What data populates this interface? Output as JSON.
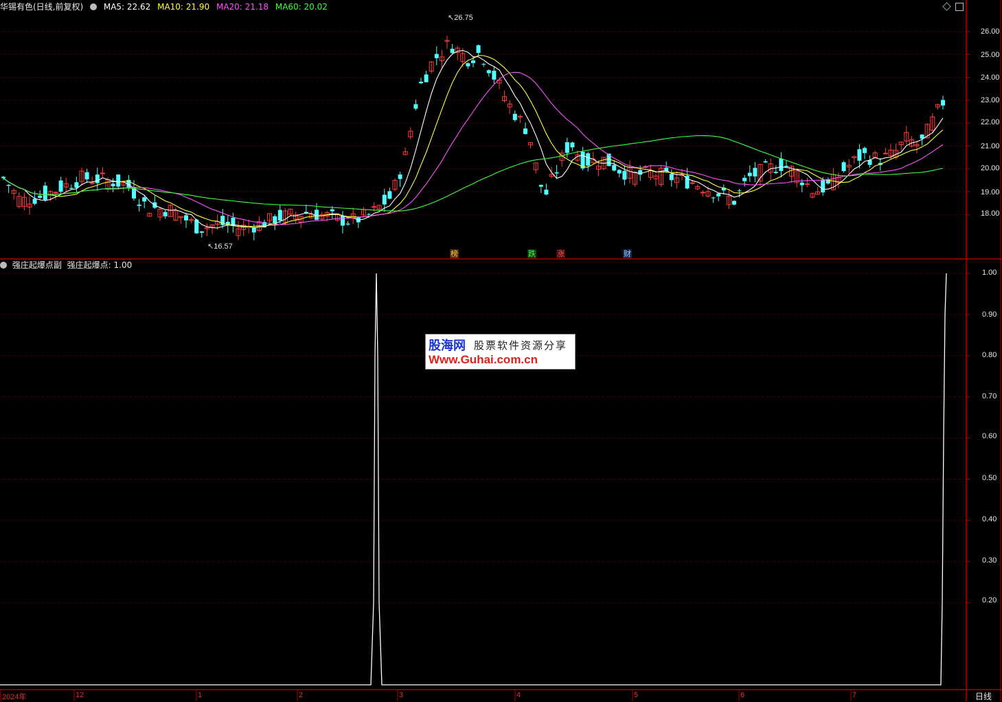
{
  "header": {
    "stock_title": "华锡有色(日线,前复权)",
    "ma5": "MA5: 22.62",
    "ma10": "MA10: 21.90",
    "ma20": "MA20: 21.18",
    "ma60": "MA60: 20.02"
  },
  "indicator_header": {
    "name": "强庄起爆点副",
    "value": "强庄起爆点: 1.00"
  },
  "price_annotations": {
    "high": "26.75",
    "low": "16.57"
  },
  "tags": [
    "榜",
    "跌",
    "涨",
    "财"
  ],
  "price_axis": [
    "26.00",
    "25.00",
    "24.00",
    "23.00",
    "22.00",
    "21.00",
    "20.00",
    "19.00",
    "18.00"
  ],
  "indicator_axis": [
    "1.00",
    "0.90",
    "0.80",
    "0.70",
    "0.60",
    "0.50",
    "0.40",
    "0.30",
    "0.20"
  ],
  "date_axis": [
    "2024年",
    "12",
    "1",
    "2",
    "3",
    "4",
    "5",
    "6",
    "7"
  ],
  "period_label": "日线",
  "watermark": {
    "logo": "股海网",
    "slogan": "股票软件资源分享",
    "url": "Www.Guhai.com.cn"
  },
  "colors": {
    "up": "#ff3c3c",
    "down": "#54ffff",
    "ma5": "#ffffff",
    "ma10": "#ffff3c",
    "ma20": "#ff50ff",
    "ma60": "#3cff3c",
    "grid": "#8b0000",
    "border": "#b00000"
  },
  "chart_data": [
    {
      "type": "line",
      "title": "华锡有色(日线,前复权)",
      "ylim": [
        16.8,
        27.2
      ],
      "series": [
        {
          "name": "MA5",
          "values": [
            22.62
          ]
        },
        {
          "name": "MA10",
          "values": [
            21.9
          ]
        },
        {
          "name": "MA20",
          "values": [
            21.18
          ]
        },
        {
          "name": "MA60",
          "values": [
            20.02
          ]
        }
      ],
      "annotations": [
        {
          "label": "26.75"
        },
        {
          "label": "16.57"
        }
      ],
      "grid": true
    },
    {
      "type": "line",
      "title": "强庄起爆点副",
      "ylim": [
        0,
        1.0
      ],
      "series": [
        {
          "name": "强庄起爆点",
          "values": [
            0,
            1,
            0,
            1
          ]
        }
      ],
      "grid": true
    }
  ]
}
